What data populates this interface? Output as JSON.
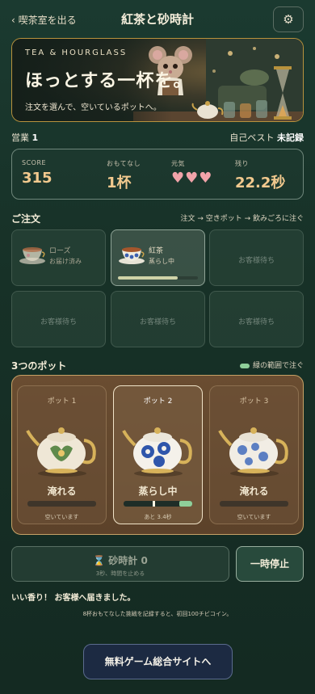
{
  "header": {
    "back_label": "‹ 喫茶室を出る",
    "title": "紅茶と砂時計",
    "settings_icon": "gear-icon",
    "settings_glyph": "⚙"
  },
  "hero": {
    "subtitle": "TEA & HOURGLASS",
    "headline": "ほっとする一杯を。",
    "description": "注文を選んで、空いているポットへ。"
  },
  "meta": {
    "business_label": "営業",
    "business_value": "1",
    "best_label": "自己ベスト",
    "best_value": "未記録"
  },
  "stats": {
    "score_label": "SCORE",
    "score_value": "315",
    "served_label": "おもてなし",
    "served_value": "1杯",
    "energy_label": "元気",
    "energy_hearts": "♥♥♥",
    "energy_value": 3,
    "time_label": "残り",
    "time_value": "22.2秒"
  },
  "orders": {
    "title": "ご注文",
    "hint": "注文 → 空きポット → 飲みごろに注ぐ",
    "items": [
      {
        "name": "ローズ",
        "status": "お届け済み"
      },
      {
        "name": "紅茶",
        "status": "蒸らし中",
        "progress": 0.75
      },
      {
        "waiting": "お客様待ち"
      },
      {
        "waiting": "お客様待ち"
      },
      {
        "waiting": "お客様待ち"
      },
      {
        "waiting": "お客様待ち"
      }
    ]
  },
  "pots": {
    "title": "3つのポット",
    "hint": "緑の範囲で注ぐ",
    "items": [
      {
        "label": "ポット 1",
        "state": "淹れる",
        "note": "空いています"
      },
      {
        "label": "ポット 2",
        "state": "蒸らし中",
        "note": "あと 3.4秒"
      },
      {
        "label": "ポット 3",
        "state": "淹れる",
        "note": "空いています"
      }
    ]
  },
  "controls": {
    "hourglass_icon": "hourglass-icon",
    "hourglass_glyph": "⌛",
    "hourglass_label": "砂時計 0",
    "hourglass_sub": "3秒、時間を止める",
    "pause_label": "一時停止"
  },
  "message": "いい香り！ お客様へ届きました。",
  "footer_note": "8杯おもてなした挑戦を記録すると、初回100チビコイン。",
  "free_site_label": "無料ゲーム総合サイトへ",
  "colors": {
    "accent_gold": "#f2c98e",
    "heart_pink": "#f1a3a9",
    "brew_green": "#8fcf9a",
    "background": "#173127"
  }
}
